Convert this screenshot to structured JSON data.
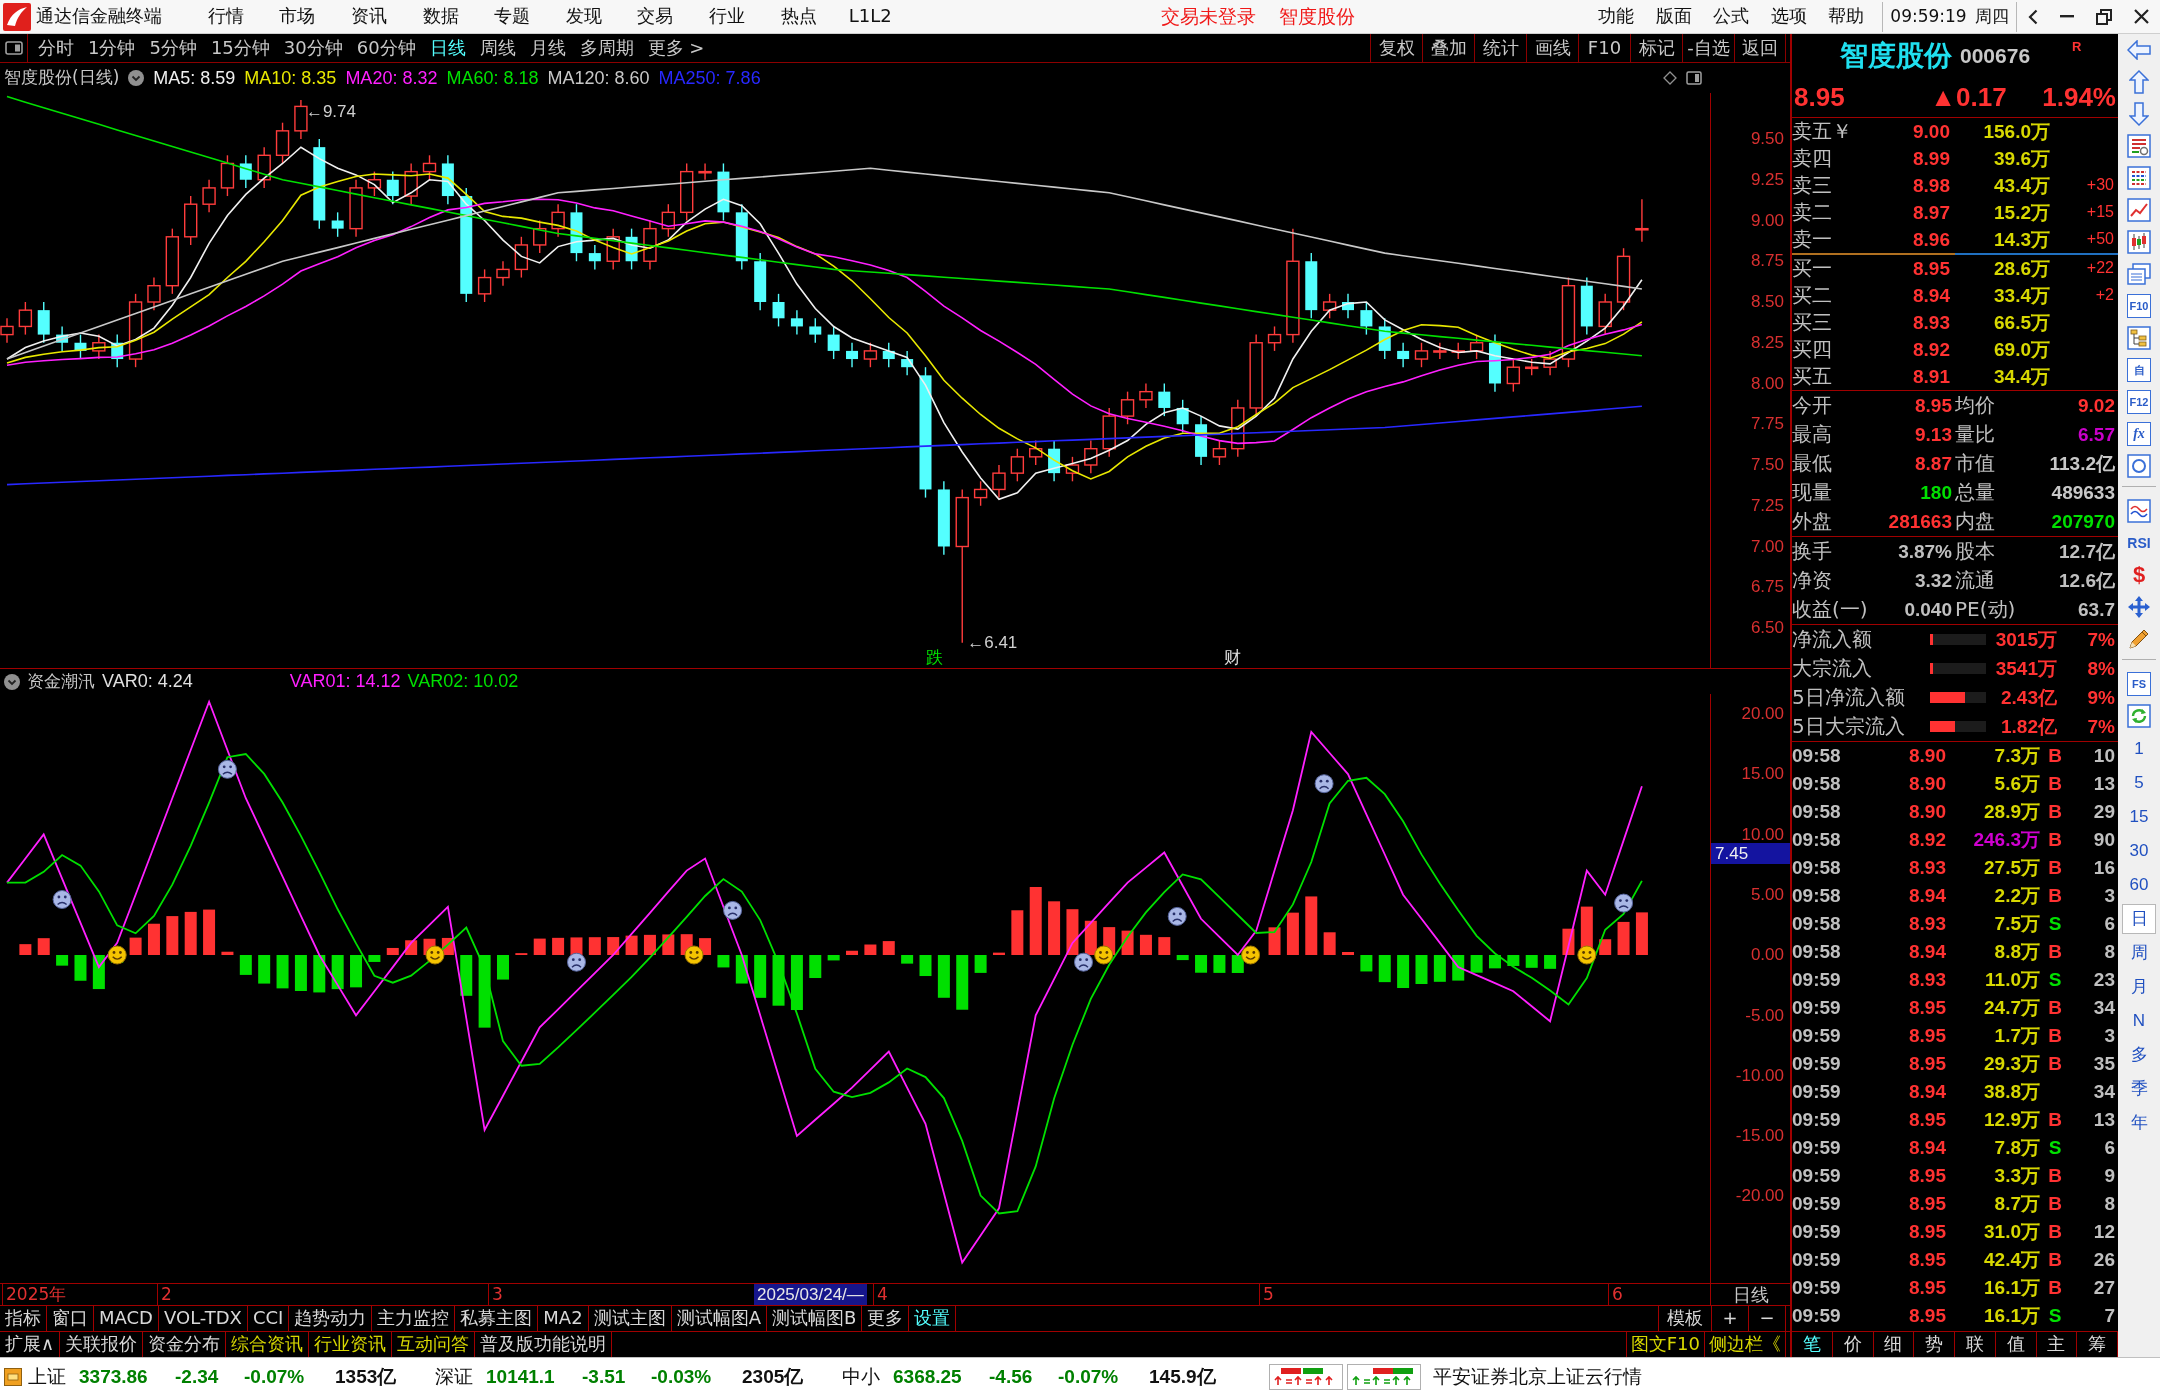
{
  "title_bar": {
    "app_name": "通达信金融终端",
    "menu": [
      "行情",
      "市场",
      "资讯",
      "数据",
      "专题",
      "发现",
      "交易",
      "行业",
      "热点",
      "L1L2"
    ],
    "notices": [
      "交易未登录",
      "智度股份"
    ],
    "right_menu": [
      "功能",
      "版面",
      "公式",
      "选项",
      "帮助"
    ],
    "time": "09:59:19",
    "weekday": "周四"
  },
  "toolbar": {
    "periods": [
      {
        "label": "分时",
        "selected": false
      },
      {
        "label": "1分钟",
        "selected": false
      },
      {
        "label": "5分钟",
        "selected": false
      },
      {
        "label": "15分钟",
        "selected": false
      },
      {
        "label": "30分钟",
        "selected": false
      },
      {
        "label": "60分钟",
        "selected": false
      },
      {
        "label": "日线",
        "selected": true
      },
      {
        "label": "周线",
        "selected": false
      },
      {
        "label": "月线",
        "selected": false
      },
      {
        "label": "多周期",
        "selected": false
      },
      {
        "label": "更多 >",
        "selected": false
      }
    ],
    "buttons": [
      "复权",
      "叠加",
      "统计",
      "画线",
      "F10",
      "标记",
      "-自选",
      "返回"
    ]
  },
  "price_chart": {
    "title": "智度股份(日线)",
    "legend": [
      {
        "label": "MA5: 8.59",
        "color": "#f0f0f0"
      },
      {
        "label": "MA10: 8.35",
        "color": "#e8e800"
      },
      {
        "label": "MA20: 8.32",
        "color": "#ff20ff"
      },
      {
        "label": "MA60: 8.18",
        "color": "#00e000"
      },
      {
        "label": "MA120: 8.60",
        "color": "#c8c8c8"
      },
      {
        "label": "MA250: 7.86",
        "color": "#2828ff"
      }
    ],
    "axis_labels": [
      "9.50",
      "9.25",
      "9.00",
      "8.75",
      "8.50",
      "8.25",
      "8.00",
      "7.75",
      "7.50",
      "7.25",
      "7.00",
      "6.75",
      "6.50"
    ],
    "price_marks": [
      {
        "text": "←9.74",
        "kind": "high"
      },
      {
        "text": "←6.41",
        "kind": "low"
      }
    ],
    "event_marks": [
      {
        "text": "跌",
        "color": "#00e000"
      },
      {
        "text": "财",
        "color": "#e0e0e0"
      }
    ]
  },
  "indicator": {
    "title": "资金潮汛",
    "readouts": [
      {
        "label": "VAR0: 4.24",
        "color": "#e0e0e0"
      },
      {
        "label": "VAR01: 14.12",
        "color": "#ff20ff"
      },
      {
        "label": "VAR02: 10.02",
        "color": "#00e000"
      }
    ],
    "axis_labels": [
      "20.00",
      "15.00",
      "10.00",
      "5.00",
      "0.00",
      "-5.00",
      "-10.00",
      "-15.00",
      "-20.00"
    ],
    "cursor_value": "7.45"
  },
  "date_axis": {
    "labels": [
      "2025年",
      "2",
      "3",
      "4",
      "5",
      "6"
    ],
    "cursor_date": "2025/03/24/—",
    "period": "日线"
  },
  "bottom_tabs": {
    "row_1": [
      {
        "label": "指标",
        "highlighted": false
      },
      {
        "label": "窗口",
        "highlighted": false
      },
      {
        "label": "MACD",
        "highlighted": false
      },
      {
        "label": "VOL-TDX",
        "highlighted": false
      },
      {
        "label": "CCI",
        "highlighted": false
      },
      {
        "label": "趋势动力",
        "highlighted": false
      },
      {
        "label": "主力监控",
        "highlighted": false
      },
      {
        "label": "私募主图",
        "highlighted": false
      },
      {
        "label": "MA2",
        "highlighted": false
      },
      {
        "label": "测试主图",
        "highlighted": false
      },
      {
        "label": "测试幅图A",
        "highlighted": false
      },
      {
        "label": "测试幅图B",
        "highlighted": false
      },
      {
        "label": "更多",
        "highlighted": false
      },
      {
        "label": "设置",
        "highlighted": true
      }
    ],
    "row_2": [
      {
        "label": "扩展∧",
        "highlighted": false
      },
      {
        "label": "关联报价",
        "highlighted": false
      },
      {
        "label": "资金分布",
        "highlighted": false
      },
      {
        "label": "综合资讯",
        "highlighted": true
      },
      {
        "label": "行业资讯",
        "highlighted": true
      },
      {
        "label": "互动问答",
        "highlighted": true
      },
      {
        "label": "普及版功能说明",
        "highlighted": false
      }
    ],
    "template_controls": [
      "模板",
      "+",
      "−"
    ],
    "side_links": [
      "图文F10",
      "侧边栏《"
    ]
  },
  "quote_panel": {
    "name": "智度股份",
    "code": "000676",
    "badge": "R",
    "rising": true,
    "price": "8.95",
    "change": "▲0.17",
    "change_pct": "1.94%",
    "asks": [
      {
        "label": "卖五￥",
        "price": "9.00",
        "volume": "156.0万"
      },
      {
        "label": "卖四",
        "price": "8.99",
        "volume": "39.6万"
      },
      {
        "label": "卖三",
        "price": "8.98",
        "volume": "43.4万",
        "change": "+30"
      },
      {
        "label": "卖二",
        "price": "8.97",
        "volume": "15.2万",
        "change": "+15"
      },
      {
        "label": "卖一",
        "price": "8.96",
        "volume": "14.3万",
        "change": "+50"
      }
    ],
    "bids": [
      {
        "label": "买一",
        "price": "8.95",
        "volume": "28.6万",
        "change": "+22"
      },
      {
        "label": "买二",
        "price": "8.94",
        "volume": "33.4万",
        "change": "+2"
      },
      {
        "label": "买三",
        "price": "8.93",
        "volume": "66.5万"
      },
      {
        "label": "买四",
        "price": "8.92",
        "volume": "69.0万"
      },
      {
        "label": "买五",
        "price": "8.91",
        "volume": "34.4万"
      }
    ],
    "stats": [
      {
        "label": "今开",
        "value": "8.95",
        "color": "#ff3232"
      },
      {
        "label": "均价",
        "value": "9.02",
        "color": "#ff3232"
      },
      {
        "label": "最高",
        "value": "9.13",
        "color": "#ff3232"
      },
      {
        "label": "量比",
        "value": "6.57",
        "color": "#c800c8"
      },
      {
        "label": "最低",
        "value": "8.87",
        "color": "#ff3232"
      },
      {
        "label": "市值",
        "value": "113.2亿",
        "color": "#c8c8c8"
      },
      {
        "label": "现量",
        "value": "180",
        "color": "#00e000"
      },
      {
        "label": "总量",
        "value": "489633",
        "color": "#c8c8c8"
      },
      {
        "label": "外盘",
        "value": "281663",
        "color": "#ff3232"
      },
      {
        "label": "内盘",
        "value": "207970",
        "color": "#00e000"
      }
    ],
    "fundamentals": [
      {
        "label": "换手",
        "value": "3.87%"
      },
      {
        "label": "股本",
        "value": "12.7亿"
      },
      {
        "label": "净资",
        "value": "3.32"
      },
      {
        "label": "流通",
        "value": "12.6亿"
      },
      {
        "label": "收益(一)",
        "value": "0.040"
      },
      {
        "label": "PE(动)",
        "value": "63.7"
      }
    ],
    "flows": [
      {
        "label": "净流入额",
        "level": 0.05,
        "value": "3015万",
        "pct": "7%"
      },
      {
        "label": "大宗流入",
        "level": 0.05,
        "value": "3541万",
        "pct": "8%"
      },
      {
        "label": "5日净流入额",
        "level": 0.62,
        "value": "2.43亿",
        "pct": "9%"
      },
      {
        "label": "5日大宗流入",
        "level": 0.44,
        "value": "1.82亿",
        "pct": "7%"
      }
    ],
    "ticks": [
      {
        "time": "09:58",
        "price": "8.90",
        "volume": "7.3万",
        "side": "B",
        "kind": "buy",
        "count": "10",
        "large": false
      },
      {
        "time": "09:58",
        "price": "8.90",
        "volume": "5.6万",
        "side": "B",
        "kind": "buy",
        "count": "13",
        "large": false
      },
      {
        "time": "09:58",
        "price": "8.90",
        "volume": "28.9万",
        "side": "B",
        "kind": "buy",
        "count": "29",
        "large": false
      },
      {
        "time": "09:58",
        "price": "8.92",
        "volume": "246.3万",
        "side": "B",
        "kind": "buy",
        "count": "90",
        "large": true
      },
      {
        "time": "09:58",
        "price": "8.93",
        "volume": "27.5万",
        "side": "B",
        "kind": "buy",
        "count": "16",
        "large": false
      },
      {
        "time": "09:58",
        "price": "8.94",
        "volume": "2.2万",
        "side": "B",
        "kind": "buy",
        "count": "3",
        "large": false
      },
      {
        "time": "09:58",
        "price": "8.93",
        "volume": "7.5万",
        "side": "S",
        "kind": "sell",
        "count": "6",
        "large": false
      },
      {
        "time": "09:58",
        "price": "8.94",
        "volume": "8.8万",
        "side": "B",
        "kind": "buy",
        "count": "8",
        "large": false
      },
      {
        "time": "09:59",
        "price": "8.93",
        "volume": "11.0万",
        "side": "S",
        "kind": "sell",
        "count": "23",
        "large": false
      },
      {
        "time": "09:59",
        "price": "8.95",
        "volume": "24.7万",
        "side": "B",
        "kind": "buy",
        "count": "34",
        "large": false
      },
      {
        "time": "09:59",
        "price": "8.95",
        "volume": "1.7万",
        "side": "B",
        "kind": "buy",
        "count": "3",
        "large": false
      },
      {
        "time": "09:59",
        "price": "8.95",
        "volume": "29.3万",
        "side": "B",
        "kind": "buy",
        "count": "35",
        "large": false
      },
      {
        "time": "09:59",
        "price": "8.94",
        "volume": "38.8万",
        "kind": "neutral",
        "count": "34",
        "large": false
      },
      {
        "time": "09:59",
        "price": "8.95",
        "volume": "12.9万",
        "side": "B",
        "kind": "buy",
        "count": "13",
        "large": false
      },
      {
        "time": "09:59",
        "price": "8.94",
        "volume": "7.8万",
        "side": "S",
        "kind": "sell",
        "count": "6",
        "large": false
      },
      {
        "time": "09:59",
        "price": "8.95",
        "volume": "3.3万",
        "side": "B",
        "kind": "buy",
        "count": "9",
        "large": false
      },
      {
        "time": "09:59",
        "price": "8.95",
        "volume": "8.7万",
        "side": "B",
        "kind": "buy",
        "count": "8",
        "large": false
      },
      {
        "time": "09:59",
        "price": "8.95",
        "volume": "31.0万",
        "side": "B",
        "kind": "buy",
        "count": "12",
        "large": false
      },
      {
        "time": "09:59",
        "price": "8.95",
        "volume": "42.4万",
        "side": "B",
        "kind": "buy",
        "count": "26",
        "large": false
      },
      {
        "time": "09:59",
        "price": "8.95",
        "volume": "16.1万",
        "side": "B",
        "kind": "buy",
        "count": "27",
        "large": false
      },
      {
        "time": "09:59",
        "price": "8.95",
        "volume": "16.1万",
        "side": "S",
        "kind": "sell",
        "count": "7",
        "large": false
      }
    ],
    "tabs": [
      {
        "label": "笔",
        "selected": true
      },
      {
        "label": "价",
        "selected": false
      },
      {
        "label": "细",
        "selected": false
      },
      {
        "label": "势",
        "selected": false
      },
      {
        "label": "联",
        "selected": false
      },
      {
        "label": "值",
        "selected": false
      },
      {
        "label": "主",
        "selected": false
      },
      {
        "label": "筹",
        "selected": false
      }
    ]
  },
  "side_strip": {
    "tools": [
      "F10",
      "自",
      "F12",
      "fx",
      "RSI",
      "$",
      "FS"
    ],
    "periods": [
      {
        "label": "1",
        "selected": false
      },
      {
        "label": "5",
        "selected": false
      },
      {
        "label": "15",
        "selected": false
      },
      {
        "label": "30",
        "selected": false
      },
      {
        "label": "60",
        "selected": false
      },
      {
        "label": "日",
        "selected": true
      },
      {
        "label": "周",
        "selected": false
      },
      {
        "label": "月",
        "selected": false
      },
      {
        "label": "N",
        "selected": false
      },
      {
        "label": "多",
        "selected": false
      },
      {
        "label": "季",
        "selected": false
      },
      {
        "label": "年",
        "selected": false
      }
    ]
  },
  "status_bar": {
    "indices": [
      {
        "name": "上证",
        "value": "3373.86",
        "change": "-2.34",
        "change_pct": "-0.07%",
        "turnover": "1353亿",
        "falling": true
      },
      {
        "name": "深证",
        "value": "10141.1",
        "change": "-3.51",
        "change_pct": "-0.03%",
        "turnover": "2305亿",
        "falling": true
      },
      {
        "name": "中小",
        "value": "6368.25",
        "change": "-4.56",
        "change_pct": "-0.07%",
        "turnover": "145.9亿",
        "falling": true
      }
    ],
    "feed": "平安证券北京上证云行情"
  }
}
